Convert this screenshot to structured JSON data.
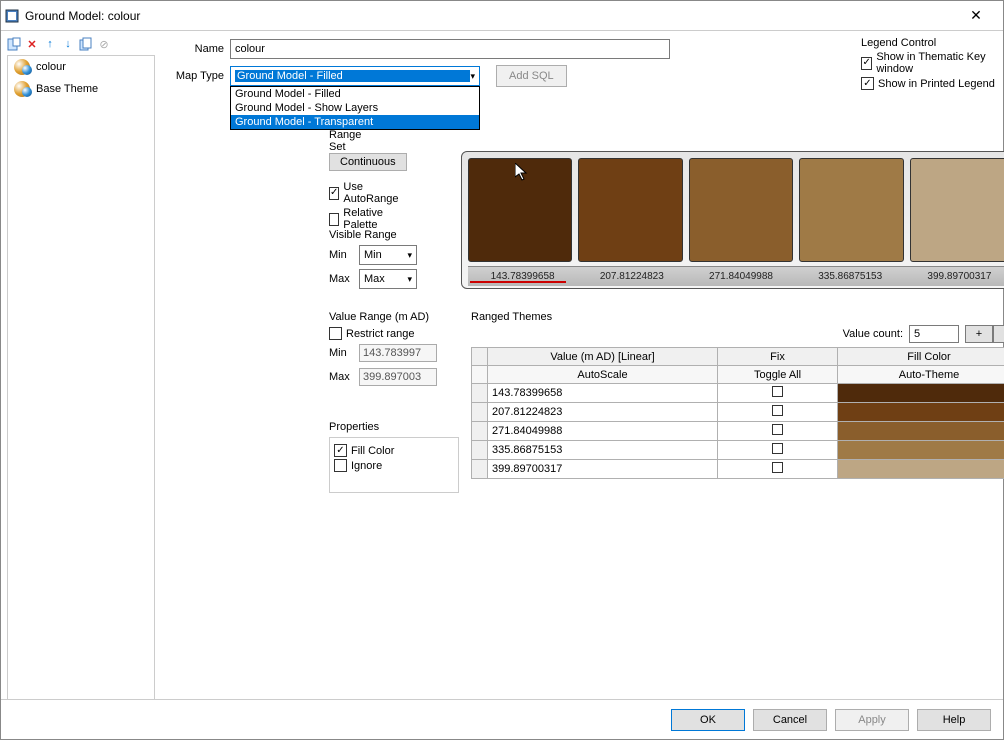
{
  "title": "Ground Model: colour",
  "tree": {
    "items": [
      "colour",
      "Base Theme"
    ]
  },
  "name": {
    "label": "Name",
    "value": "colour"
  },
  "maptype": {
    "label": "Map Type",
    "selected": "Ground Model - Filled",
    "options": [
      "Ground Model - Filled",
      "Ground Model - Show Layers",
      "Ground Model - Transparent"
    ],
    "add_sql": "Add SQL"
  },
  "legend": {
    "header": "Legend Control",
    "thematic": "Show in Thematic Key window",
    "printed": "Show in Printed Legend"
  },
  "rangeset": {
    "label": "Range Set",
    "continuous": "Continuous",
    "autorange": "Use AutoRange",
    "relative": "Relative Palette"
  },
  "visible": {
    "label": "Visible Range",
    "min_label": "Min",
    "min_value": "Min",
    "max_label": "Max",
    "max_value": "Max"
  },
  "palette": {
    "colors": [
      "#4f2a0b",
      "#6f3f14",
      "#8a5e2c",
      "#9f7a46",
      "#bda684"
    ],
    "labels": [
      "143.78399658",
      "207.81224823",
      "271.84049988",
      "335.86875153",
      "399.89700317"
    ]
  },
  "valuerange": {
    "label": "Value Range (m AD)",
    "restrict": "Restrict range",
    "min_label": "Min",
    "min_value": "143.783997",
    "max_label": "Max",
    "max_value": "399.897003"
  },
  "props": {
    "label": "Properties",
    "fill": "Fill Color",
    "ignore": "Ignore"
  },
  "ranged": {
    "header": "Ranged Themes",
    "valuecount_label": "Value count:",
    "valuecount": "5",
    "plus": "+",
    "minus": "-",
    "col_value": "Value (m AD) [Linear]",
    "col_fix": "Fix",
    "col_fill": "Fill Color",
    "sub_auto": "AutoScale",
    "sub_toggle": "Toggle All",
    "sub_theme": "Auto-Theme",
    "rows": [
      {
        "value": "143.78399658",
        "fill": "#4f2a0b"
      },
      {
        "value": "207.81224823",
        "fill": "#6f3f14"
      },
      {
        "value": "271.84049988",
        "fill": "#8a5e2c"
      },
      {
        "value": "335.86875153",
        "fill": "#9f7a46"
      },
      {
        "value": "399.89700317",
        "fill": "#bda684"
      }
    ]
  },
  "footer": {
    "ok": "OK",
    "cancel": "Cancel",
    "apply": "Apply",
    "help": "Help"
  }
}
